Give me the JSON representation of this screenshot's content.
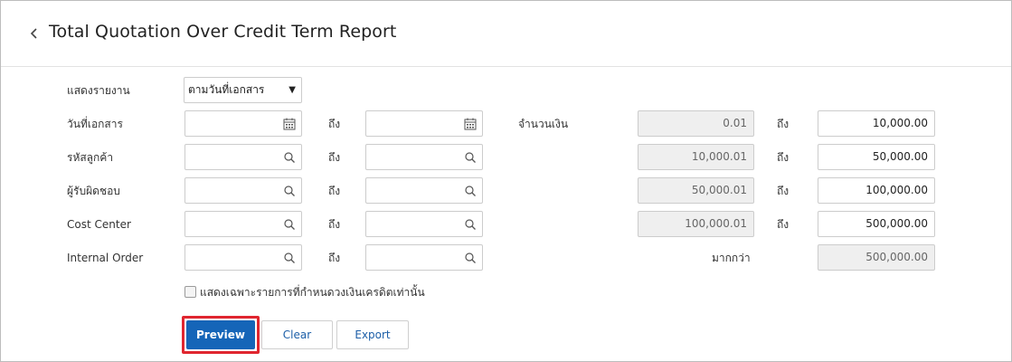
{
  "header": {
    "title": "Total Quotation Over Credit Term Report"
  },
  "form": {
    "report_label": "แสดงรายงาน",
    "report_value": "ตามวันที่เอกสาร",
    "to_label": "ถึง",
    "rows": [
      {
        "label": "วันที่เอกสาร",
        "icon": "calendar-icon"
      },
      {
        "label": "รหัสลูกค้า",
        "icon": "search-icon"
      },
      {
        "label": "ผู้รับผิดชอบ",
        "icon": "search-icon"
      },
      {
        "label": "Cost Center",
        "icon": "search-icon"
      },
      {
        "label": "Internal Order",
        "icon": "search-icon"
      }
    ],
    "amount_label": "จำนวนเงิน",
    "more_than_label": "มากกว่า",
    "amount_ranges": [
      {
        "from": "0.01",
        "to": "10,000.00"
      },
      {
        "from": "10,000.01",
        "to": "50,000.00"
      },
      {
        "from": "50,000.01",
        "to": "100,000.00"
      },
      {
        "from": "100,000.01",
        "to": "500,000.00"
      }
    ],
    "more_than_value": "500,000.00",
    "checkbox_label": "แสดงเฉพาะรายการที่กำหนดวงเงินเครดิตเท่านั้น",
    "checkbox_checked": false
  },
  "buttons": {
    "preview": "Preview",
    "clear": "Clear",
    "export": "Export"
  },
  "colors": {
    "primary": "#1565b8",
    "highlight": "#e0262f",
    "link": "#1d5fa8"
  }
}
